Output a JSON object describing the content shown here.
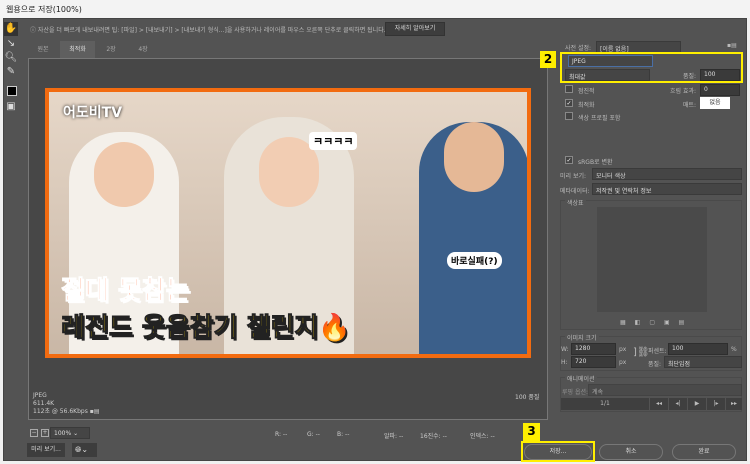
{
  "title": "웹용으로 저장(100%)",
  "info": {
    "text": "자산을 더 빠르게 내보내려면 팁: [파일] > [내보내기] > [내보내기 형식...]을 사용하거나 레이어를 마우스 오른쪽 단추로 클릭하면 됩니다.",
    "more_button": "자세히 알아보기"
  },
  "tabs": [
    "원본",
    "최적화",
    "2장",
    "4장"
  ],
  "image": {
    "channel": "어도비TV",
    "laugh": "ㅋㅋㅋㅋ",
    "fail": "바로실패(?)",
    "line1": "절대 못참는",
    "line2": "레전드 웃음참기 챌린지🔥"
  },
  "preview_status": {
    "format": "JPEG",
    "size": "611.4K",
    "time": "112초 @ 56.6Kbps",
    "quality": "100 품질"
  },
  "bottom": {
    "zoom": "100%",
    "r": "R: --",
    "g": "G: --",
    "b": "B: --",
    "alpha": "알파: --",
    "hex": "16진수: --",
    "index": "인덱스: --",
    "preview_button": "미리 보기..."
  },
  "settings": {
    "preset_label": "사전 설정:",
    "preset": "[이름 없음]",
    "format": "JPEG",
    "compression": "최대값",
    "quality_label": "품질:",
    "quality": "100",
    "progressive": "점진적",
    "blur_label": "흐림 효과:",
    "blur": "0",
    "optimized": "최적화",
    "matte_label": "매트:",
    "matte": "없음",
    "embed_profile": "색상 프로필 포함",
    "srgb": "sRGB로 변환",
    "preview_label": "미리 보기:",
    "preview": "모니터 색상",
    "metadata_label": "메타데이터:",
    "metadata": "저작권 및 연락처 정보",
    "color_table": "색상표"
  },
  "image_size": {
    "title": "이미지 크기",
    "w_label": "W:",
    "w": "1280",
    "h_label": "H:",
    "h": "720",
    "unit": "px",
    "percent_label": "퍼센트:",
    "percent": "100",
    "percent_unit": "%",
    "quality_label": "품질:",
    "quality": "최단입점"
  },
  "animation": {
    "title": "애니메이션",
    "loop_label": "루핑 옵션:",
    "loop": "계속",
    "frame": "1/1"
  },
  "buttons": {
    "save": "저장...",
    "cancel": "취소",
    "done": "완료"
  },
  "markers": [
    "2",
    "3"
  ],
  "colors": {
    "highlight": "#ffef00",
    "border": "#f26b10"
  }
}
